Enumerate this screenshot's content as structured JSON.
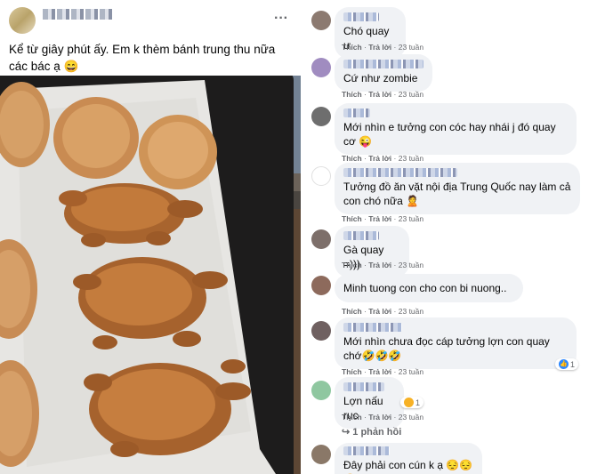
{
  "post": {
    "author": "",
    "meta": "",
    "more_icon": "more-horizontal-icon",
    "text": "Kể từ giây phút ấy. Em k thèm bánh trung thu nữa các bác ạ 😄",
    "photo": "baked pastries shaped like roasted piglets beside mooncakes on a tray"
  },
  "action_labels": {
    "like": "Thích",
    "reply": "Trả lời",
    "dot": "·"
  },
  "comments": [
    {
      "text": "Chó quay ư",
      "time": "23 tuần"
    },
    {
      "text": "Cứ như zombie",
      "time": "23 tuần"
    },
    {
      "text": "Mới nhìn e tưởng con cóc hay nhái j đó quay cơ 😜",
      "time": "23 tuần"
    },
    {
      "text": "Tưởng đồ ăn vặt nội địa Trung Quốc nay làm cả con chó nữa 🙎",
      "time": "23 tuần"
    },
    {
      "text": "Gà quay =)))",
      "time": "23 tuần"
    },
    {
      "text": "Minh tuong con cho con bi nuong..",
      "time": "23 tuần"
    },
    {
      "text": "Mới nhìn chưa đọc cáp tưởng lợn con quay chớ🤣🤣🤣",
      "time": "23 tuần",
      "reaction_count": "1"
    },
    {
      "text": "Lợn nấu rục",
      "time": "23 tuần",
      "reaction_count": "1"
    },
    {
      "text": "Đây phải con cún k ạ 😔😔😔",
      "time": ""
    }
  ],
  "replies": {
    "label": "1 phản hồi",
    "icon": "reply-arrow-icon"
  },
  "colors": {
    "bubble": "#f0f2f5",
    "meta_text": "#65676b",
    "like_blue": "#2d88ff"
  }
}
